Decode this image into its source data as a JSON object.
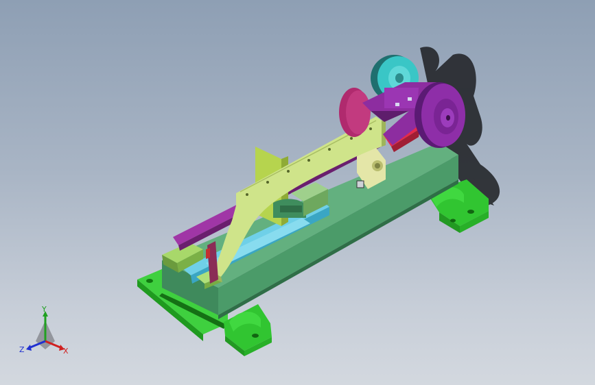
{
  "viewport": {
    "background_top": "#8e9fb4",
    "background_bottom": "#d3d8df"
  },
  "model": {
    "colors": {
      "base_plate": "#3fd03f",
      "frame_block": "#55aa77",
      "c_arm": "#c8e07a",
      "upright": "#b6d44e",
      "rail": "#4fb8d6",
      "top_bar": "#8a2b8e",
      "pulley_purple": "#8e2ea8",
      "pulley_teal": "#3bc6c6",
      "disk_magenta": "#b3296b",
      "red_link": "#c2283a"
    }
  },
  "triad": {
    "labels": {
      "x": "X",
      "y": "Y",
      "z": "Z"
    },
    "colors": {
      "x": "#d02020",
      "y": "#20a020",
      "z": "#2030d0"
    }
  }
}
